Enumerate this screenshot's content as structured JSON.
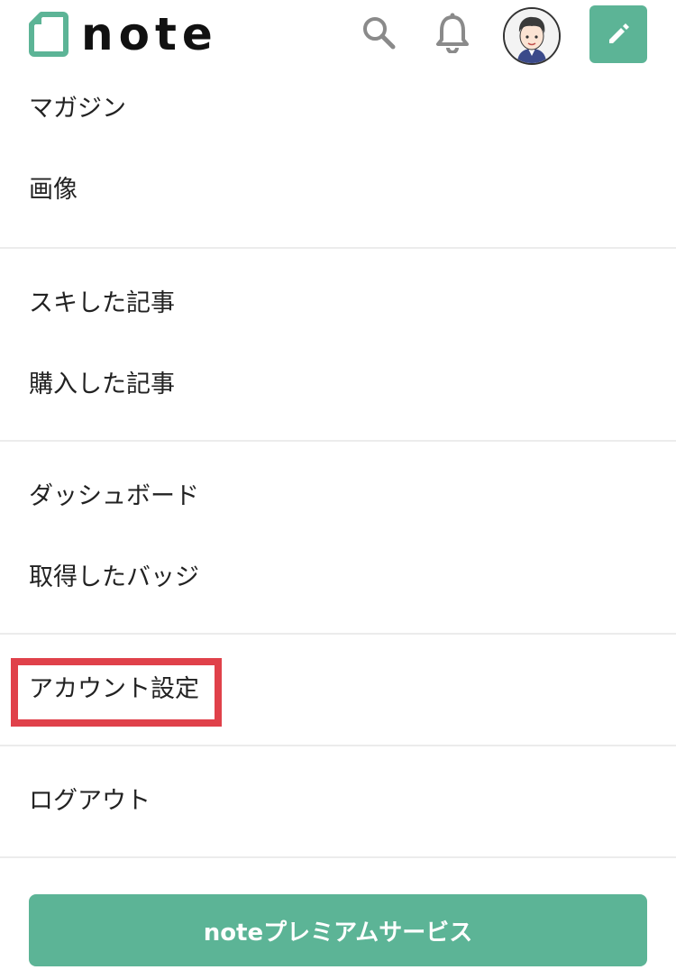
{
  "header": {
    "logo_text": "note",
    "icons": {
      "search": "search-icon",
      "notifications": "bell-icon",
      "avatar": "user-avatar",
      "post": "pencil-icon"
    }
  },
  "menu": {
    "group1": [
      "マガジン",
      "画像"
    ],
    "group2": [
      "スキした記事",
      "購入した記事"
    ],
    "group3": [
      "ダッシュボード",
      "取得したバッジ"
    ],
    "group4": [
      "アカウント設定"
    ],
    "group5": [
      "ログアウト"
    ]
  },
  "premium_button_label": "noteプレミアムサービス",
  "colors": {
    "brand_green": "#5cb496",
    "highlight_red": "#e0414a",
    "divider": "#ececec",
    "text": "#222222"
  }
}
